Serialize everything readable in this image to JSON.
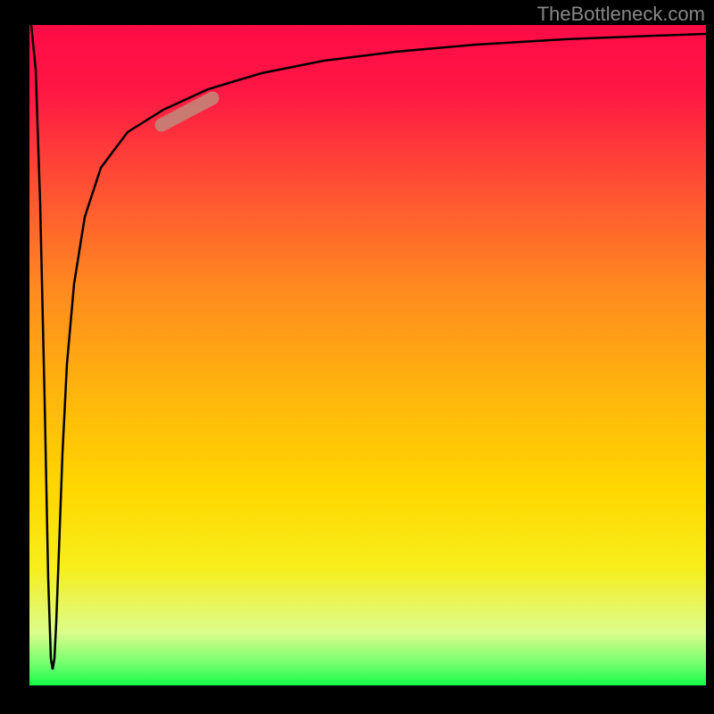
{
  "watermark": "TheBottleneck.com",
  "chart_data": {
    "type": "line",
    "title": "",
    "xlabel": "",
    "ylabel": "",
    "xlim": [
      0,
      100
    ],
    "ylim": [
      0,
      100
    ],
    "background_gradient": {
      "top": "#ff0b47",
      "middle": "#ffd600",
      "bottom": "#15fa48"
    },
    "series": [
      {
        "name": "curve",
        "description": "Sharp dip from top-left to bottom near x~3, then logarithmic rise back toward top-right",
        "x": [
          0,
          1,
          2,
          3,
          3.5,
          4,
          5,
          7,
          10,
          15,
          20,
          30,
          40,
          60,
          80,
          100
        ],
        "y": [
          100,
          60,
          20,
          3,
          20,
          40,
          60,
          75,
          83,
          88,
          91,
          94,
          96,
          97.5,
          98.5,
          99
        ]
      }
    ],
    "highlight": {
      "x_range": [
        20,
        30
      ],
      "y_range": [
        84,
        90
      ],
      "color": "#c08a7a"
    }
  }
}
